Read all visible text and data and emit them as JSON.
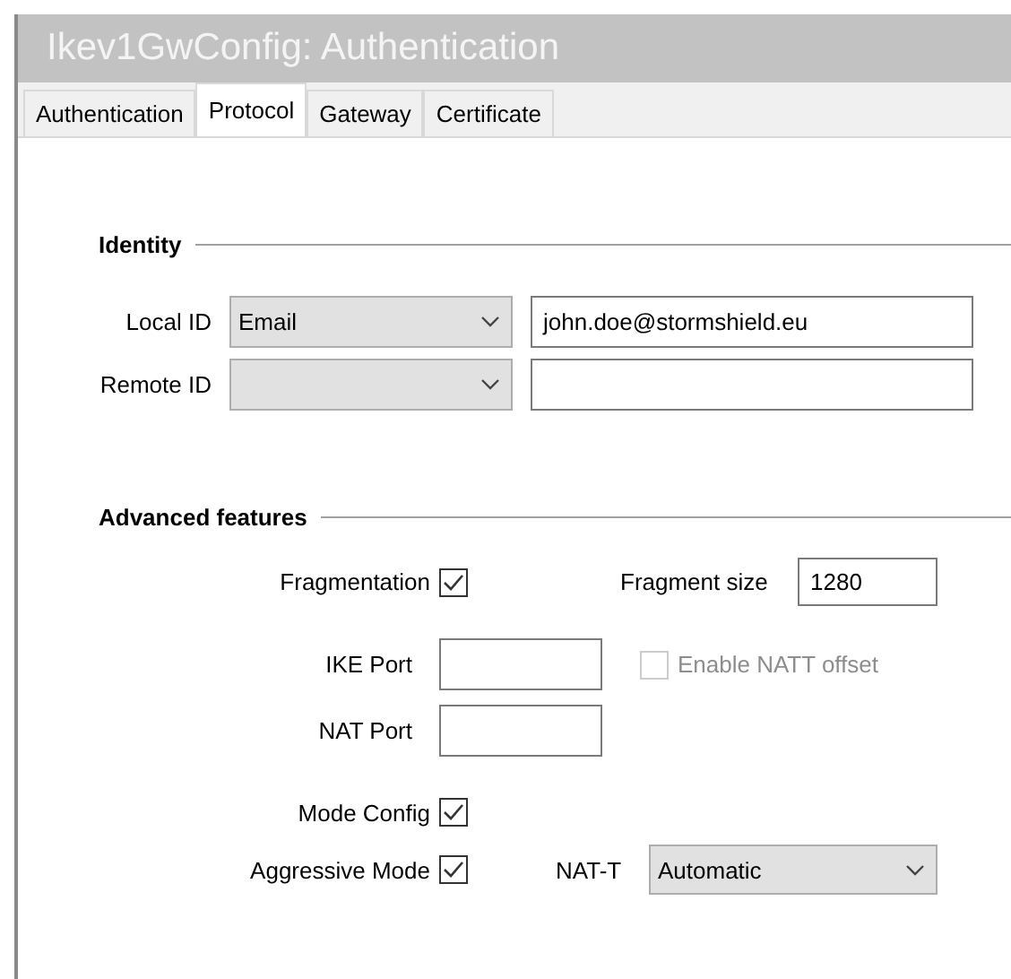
{
  "window": {
    "title": "Ikev1GwConfig: Authentication"
  },
  "tabs": [
    {
      "label": "Authentication",
      "selected": false
    },
    {
      "label": "Protocol",
      "selected": true
    },
    {
      "label": "Gateway",
      "selected": false
    },
    {
      "label": "Certificate",
      "selected": false
    }
  ],
  "identity": {
    "heading": "Identity",
    "rows": [
      {
        "label": "Local ID",
        "type": "Email",
        "value": "john.doe@stormshield.eu"
      },
      {
        "label": "Remote ID"
      }
    ]
  },
  "advanced": {
    "heading": "Advanced features",
    "fragmentation": {
      "label": "Fragmentation",
      "checked": true
    },
    "fragment_size": {
      "label": "Fragment size",
      "value": "1280"
    },
    "ike_port": {
      "label": "IKE Port"
    },
    "natt_offset": {
      "label": "Enable NATT offset",
      "checked": false,
      "disabled": true
    },
    "nat_port": {
      "label": "NAT Port"
    },
    "mode_config": {
      "label": "Mode Config",
      "checked": true
    },
    "aggressive_mode": {
      "label": "Aggressive Mode",
      "checked": true
    },
    "nat_t": {
      "label": "NAT-T",
      "value": "Automatic"
    }
  }
}
